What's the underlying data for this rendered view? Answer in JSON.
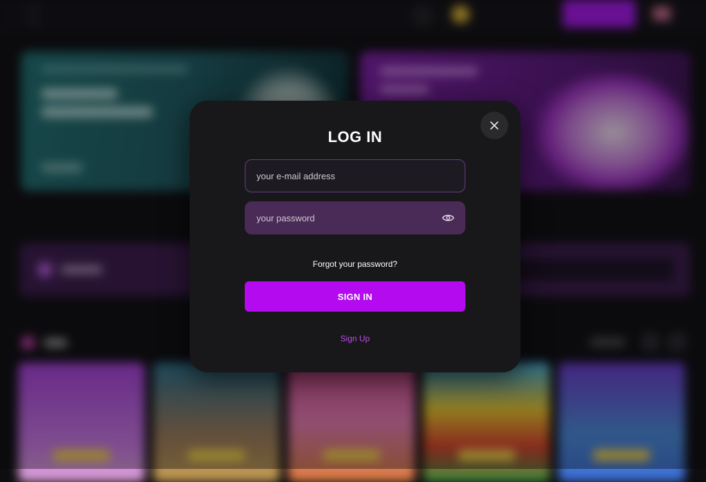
{
  "modal": {
    "title": "LOG IN",
    "email_placeholder": "your e-mail address",
    "password_placeholder": "your password",
    "forgot_label": "Forgot your password?",
    "signin_label": "SIGN IN",
    "signup_label": "Sign Up",
    "close_icon": "close-icon",
    "eye_icon": "eye-icon"
  },
  "colors": {
    "accent": "#b40af0",
    "link": "#bb4fe6",
    "modal_bg": "#18171a",
    "password_bg": "#4a2a56"
  }
}
